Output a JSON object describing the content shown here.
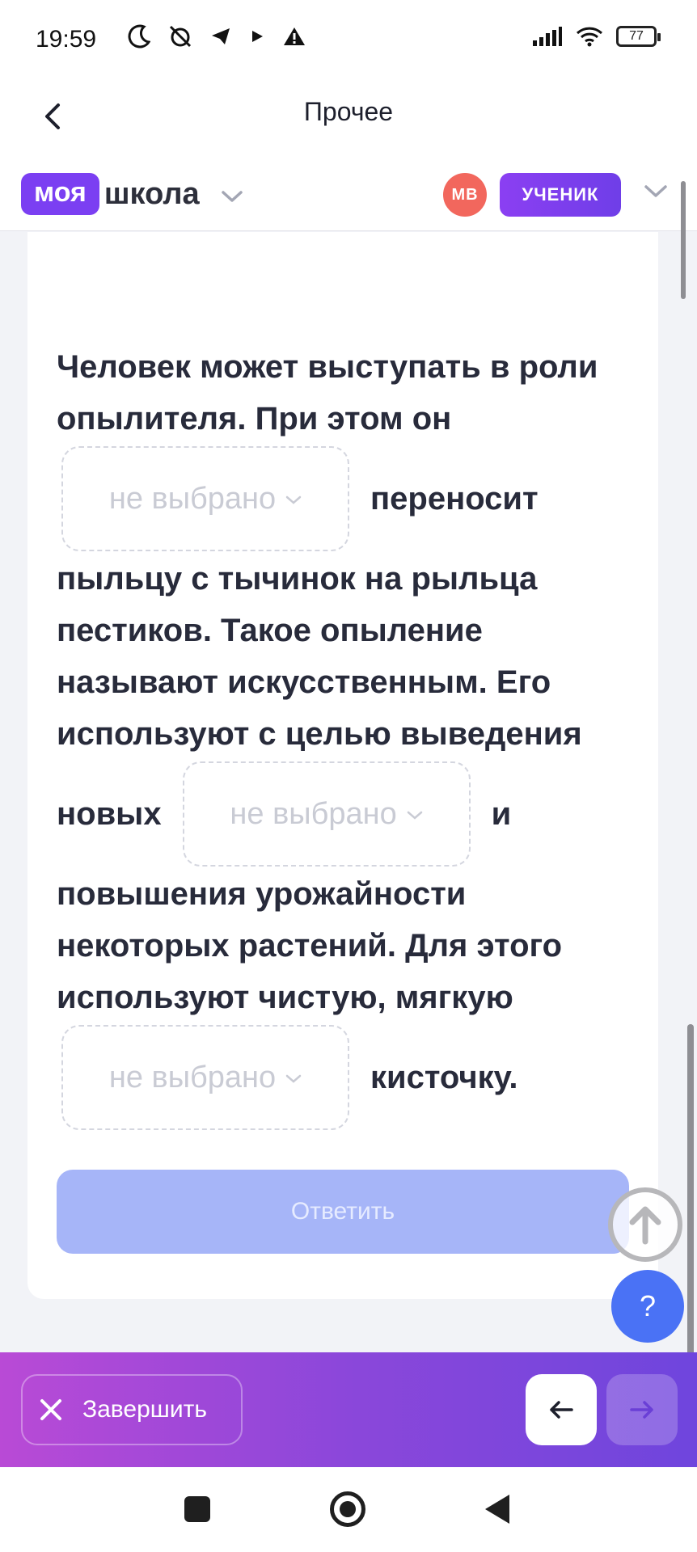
{
  "status_bar": {
    "time": "19:59",
    "battery": "77"
  },
  "header": {
    "title": "Прочее",
    "logo_badge": "моя",
    "logo_text": "школа",
    "avatar_initials": "МВ",
    "role": "УЧЕНИК"
  },
  "question": {
    "line1": "Человек может выступать в роли",
    "line2": "опылителя. При этом он",
    "select1_placeholder": "не выбрано",
    "after_select1": "переносит",
    "line3": "пыльцу с тычинок на рыльца",
    "line4": "пестиков. Такое опыление",
    "line5": "называют искусственным. Его",
    "line6": "используют с целью выведения",
    "before_select2": "новых",
    "select2_placeholder": "не выбрано",
    "after_select2": "и",
    "line7": "повышения урожайности",
    "line8": "некоторых растений. Для этого",
    "line9": "используют чистую, мягкую",
    "select3_placeholder": "не выбрано",
    "after_select3": "кисточку."
  },
  "actions": {
    "answer_label": "Ответить",
    "help_label": "?",
    "finish_label": "Завершить"
  },
  "colors": {
    "brand": "#7b3ff2",
    "answer_disabled": "#a6b5f8",
    "help": "#4a72f5",
    "avatar": "#f2675d"
  }
}
